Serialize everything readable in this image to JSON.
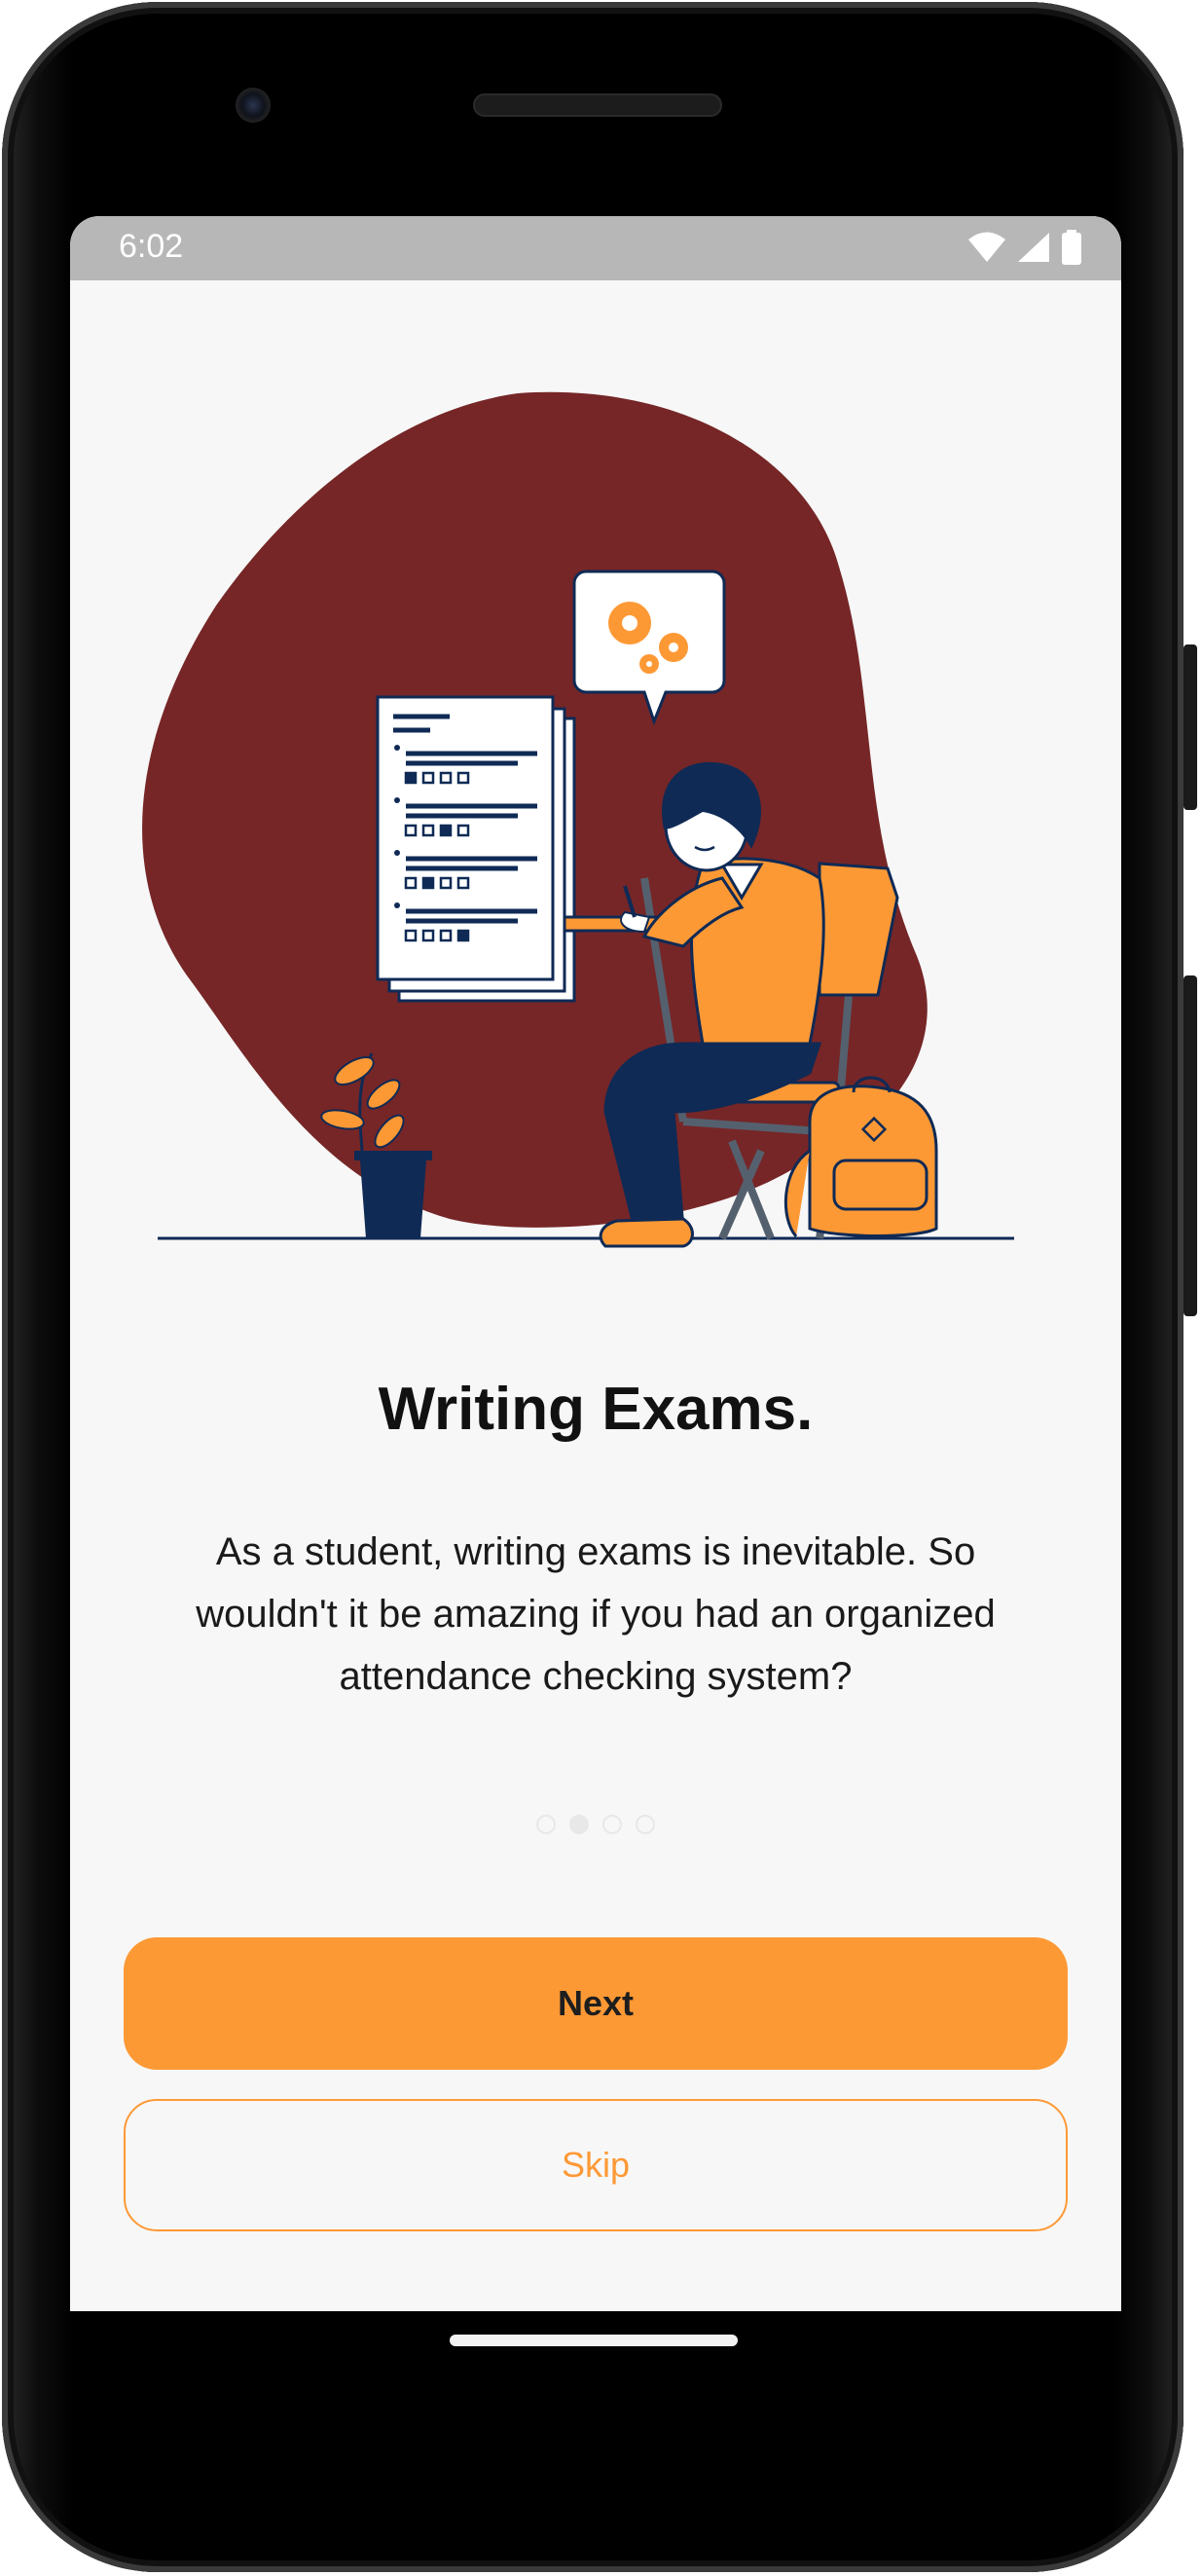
{
  "status_bar": {
    "time": "6:02",
    "icons": [
      "wifi-icon",
      "signal-icon",
      "battery-icon"
    ]
  },
  "onboarding": {
    "title": "Writing Exams.",
    "description": "As a student, writing exams is inevitable. So wouldn't it be amazing if you had an organized attendance checking system?",
    "page_indicator": {
      "total": 4,
      "current": 2
    },
    "next_label": "Next",
    "skip_label": "Skip"
  },
  "colors": {
    "accent": "#fd9935",
    "blob": "#762627",
    "navy": "#0f2a55",
    "background": "#f7f7f7",
    "status_bar": "#b7b7b7"
  }
}
